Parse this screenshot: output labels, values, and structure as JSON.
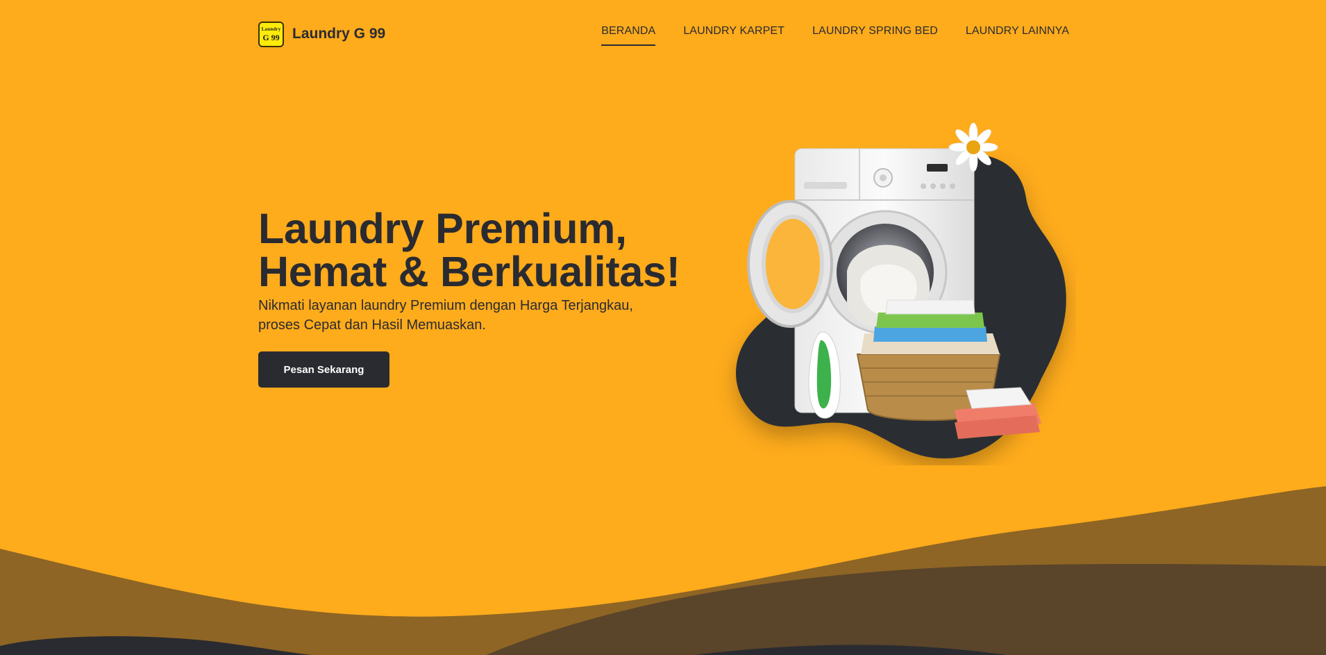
{
  "brand": {
    "logo_line1": "Laundry",
    "logo_line2": "G 99",
    "name": "Laundry G 99"
  },
  "nav": {
    "items": [
      {
        "label": "BERANDA",
        "active": true
      },
      {
        "label": "LAUNDRY KARPET",
        "active": false
      },
      {
        "label": "LAUNDRY SPRING BED",
        "active": false
      },
      {
        "label": "LAUNDRY LAINNYA",
        "active": false
      }
    ]
  },
  "hero": {
    "title_line1": "Laundry Premium,",
    "title_line2": "Hemat & Berkualitas!",
    "subtitle_line1": "Nikmati layanan laundry Premium dengan Harga Terjangkau,",
    "subtitle_line2": "proses Cepat dan Hasil Memuaskan.",
    "cta_label": "Pesan Sekarang"
  },
  "colors": {
    "background": "#FEAB1C",
    "dark": "#2A2B30",
    "wave_light": "#8E6524",
    "wave_mid": "#5A442A",
    "logo_yellow": "#FFEB0A"
  },
  "icons": {
    "logo": "laundry-g99-logo",
    "illustration": "washing-machine-laundry-illustration"
  }
}
